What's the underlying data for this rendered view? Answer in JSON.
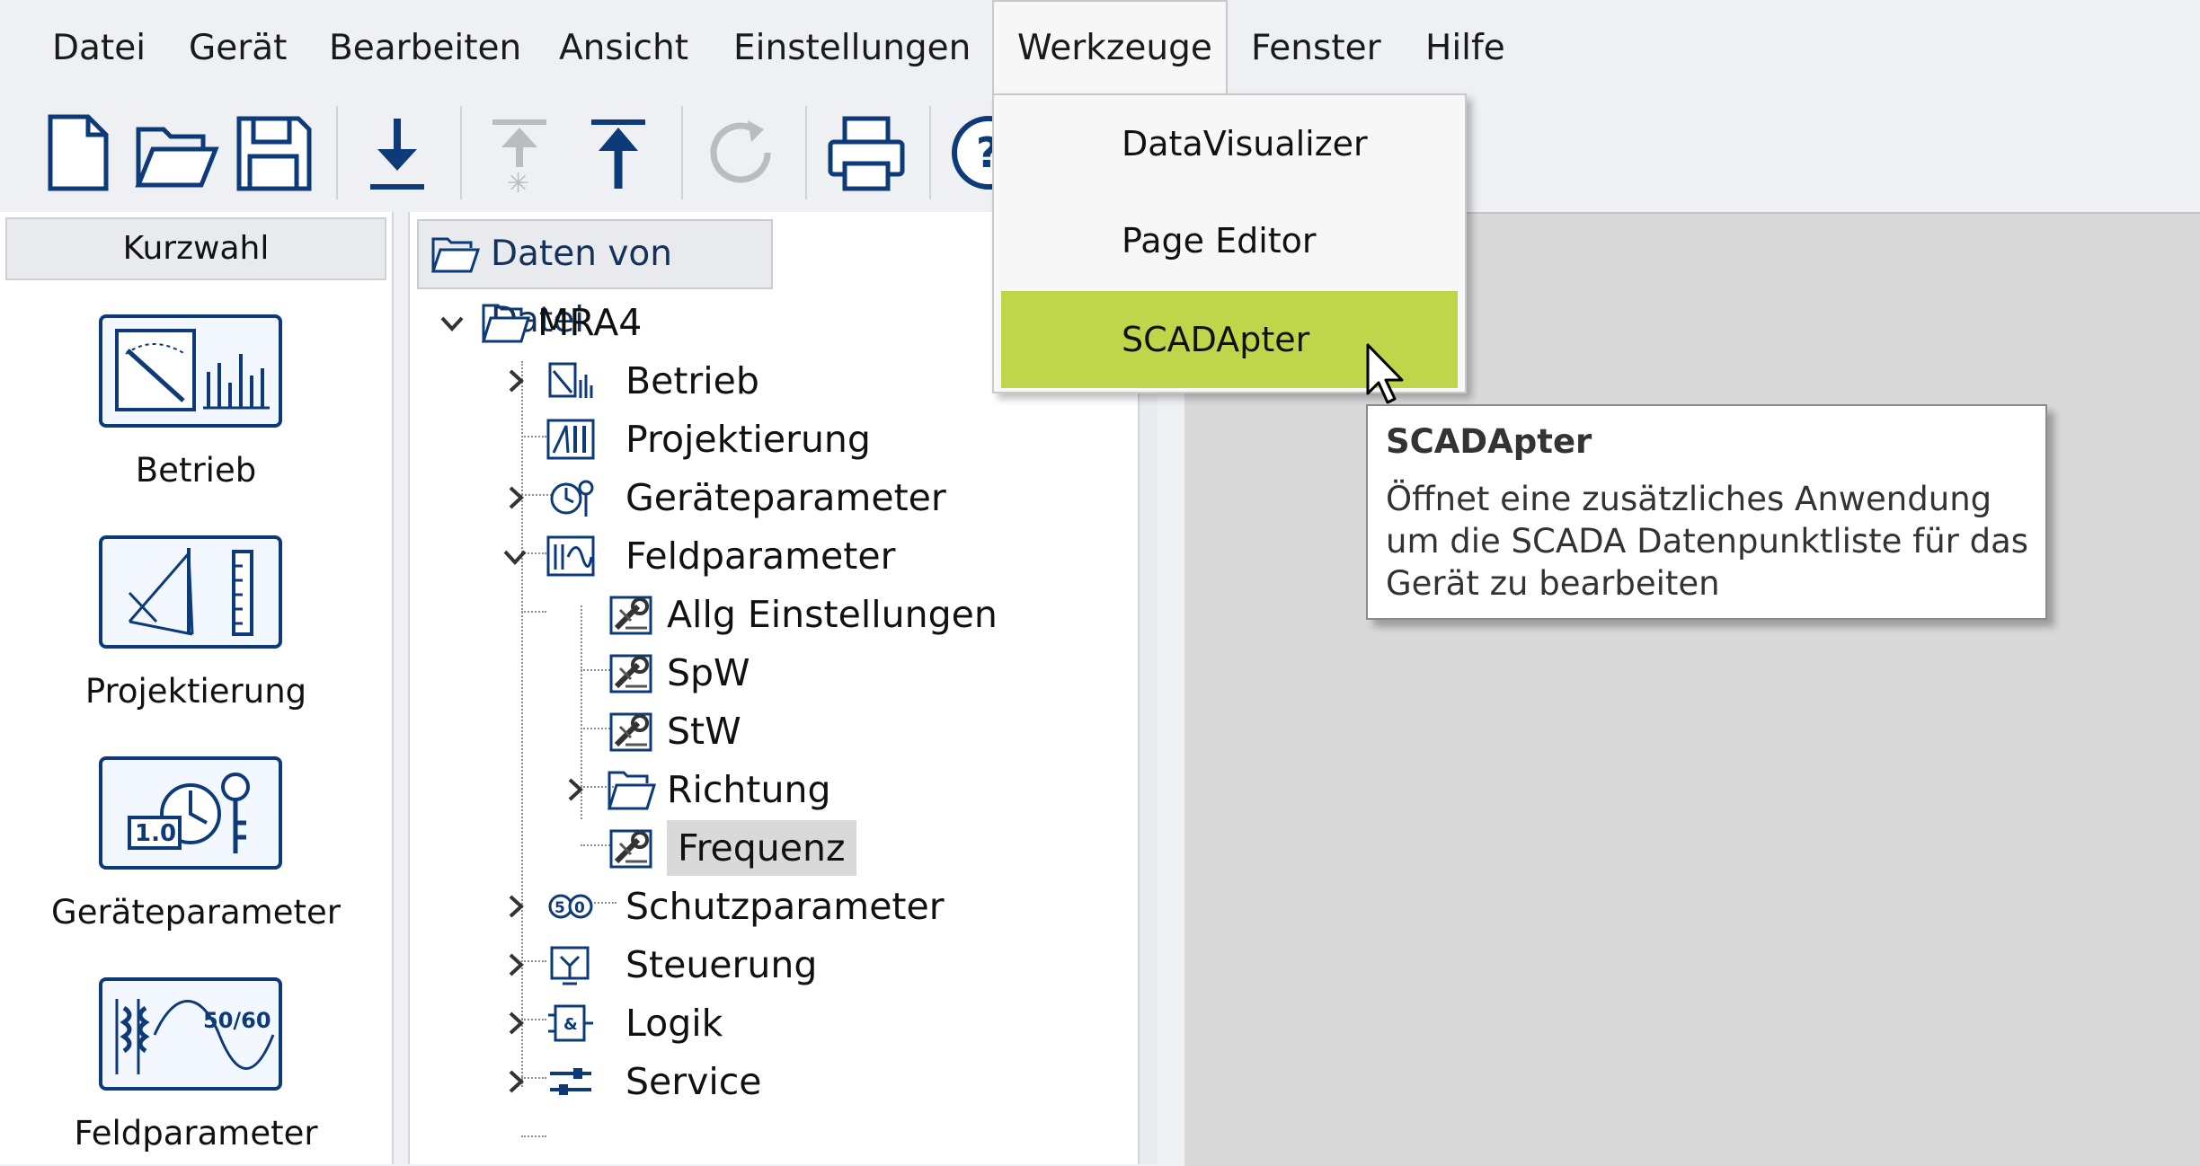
{
  "menubar": {
    "items": [
      "Datei",
      "Gerät",
      "Bearbeiten",
      "Ansicht",
      "Einstellungen",
      "Werkzeuge",
      "Fenster",
      "Hilfe"
    ],
    "open_item": "Werkzeuge"
  },
  "toolbar": {
    "icons": [
      "new-file-icon",
      "open-folder-icon",
      "save-icon",
      "download-icon",
      "upload-disabled-icon",
      "upload-icon",
      "refresh-icon",
      "print-icon",
      "help-icon"
    ]
  },
  "left_panel": {
    "header": "Kurzwahl",
    "items": [
      {
        "label": "Betrieb",
        "icon": "meter-icon"
      },
      {
        "label": "Projektierung",
        "icon": "projection-icon"
      },
      {
        "label": "Geräteparameter",
        "icon": "device-params-icon"
      },
      {
        "label": "Feldparameter",
        "icon": "field-params-icon"
      }
    ]
  },
  "tree_panel": {
    "tab_label": "Daten von Datei",
    "nodes": [
      {
        "label": "MRA4",
        "toggle": "expanded",
        "icon": "folder-icon"
      },
      {
        "label": "Betrieb",
        "toggle": "collapsed",
        "icon": "meter-icon"
      },
      {
        "label": "Projektierung",
        "toggle": "none",
        "icon": "projection-icon"
      },
      {
        "label": "Geräteparameter",
        "toggle": "collapsed",
        "icon": "device-params-icon"
      },
      {
        "label": "Feldparameter",
        "toggle": "expanded",
        "icon": "field-params-icon"
      },
      {
        "label": "Allg Einstellungen",
        "toggle": "none",
        "icon": "settings-icon"
      },
      {
        "label": "SpW",
        "toggle": "none",
        "icon": "settings-icon"
      },
      {
        "label": "StW",
        "toggle": "none",
        "icon": "settings-icon"
      },
      {
        "label": "Richtung",
        "toggle": "collapsed",
        "icon": "folder-icon"
      },
      {
        "label": "Frequenz",
        "toggle": "none",
        "icon": "settings-icon",
        "selected": true
      },
      {
        "label": "Schutzparameter",
        "toggle": "collapsed",
        "icon": "protection-icon"
      },
      {
        "label": "Steuerung",
        "toggle": "collapsed",
        "icon": "control-icon"
      },
      {
        "label": "Logik",
        "toggle": "collapsed",
        "icon": "logic-icon"
      },
      {
        "label": "Service",
        "toggle": "collapsed",
        "icon": "service-icon"
      }
    ]
  },
  "dropdown": {
    "items": [
      "DataVisualizer",
      "Page Editor",
      "SCADApter"
    ],
    "highlighted": "SCADApter"
  },
  "tooltip": {
    "title": "SCADApter",
    "body": "Öffnet eine zusätzliches Anwendung um die SCADA Datenpunktliste für das Gerät zu bearbeiten"
  },
  "colors": {
    "highlight": "#bfd64a",
    "icon_blue": "#0d3a78",
    "content_bg": "#d9d9d9"
  }
}
